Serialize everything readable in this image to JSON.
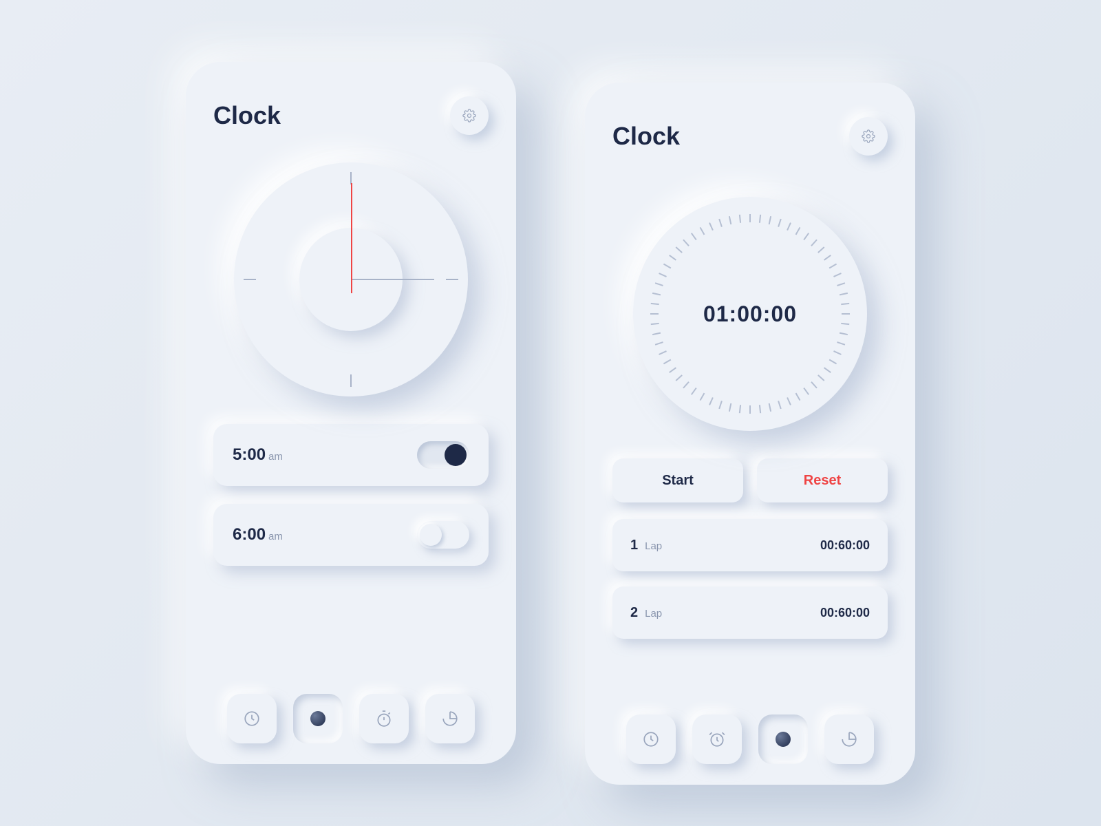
{
  "left": {
    "title": "Clock",
    "alarms": [
      {
        "time": "5:00",
        "ampm": "am",
        "enabled": true
      },
      {
        "time": "6:00",
        "ampm": "am",
        "enabled": false
      }
    ],
    "nav_active_index": 1
  },
  "right": {
    "title": "Clock",
    "stopwatch_value": "01:00:00",
    "start_label": "Start",
    "reset_label": "Reset",
    "laps": [
      {
        "n": "1",
        "label": "Lap",
        "time": "00:60:00"
      },
      {
        "n": "2",
        "label": "Lap",
        "time": "00:60:00"
      }
    ],
    "nav_active_index": 2
  },
  "colors": {
    "accent_red": "#ef4444",
    "dark": "#1e2947",
    "bg": "#eef2f8"
  },
  "nav_icons": [
    "clock-icon",
    "alarm-icon",
    "stopwatch-icon",
    "timer-icon"
  ]
}
